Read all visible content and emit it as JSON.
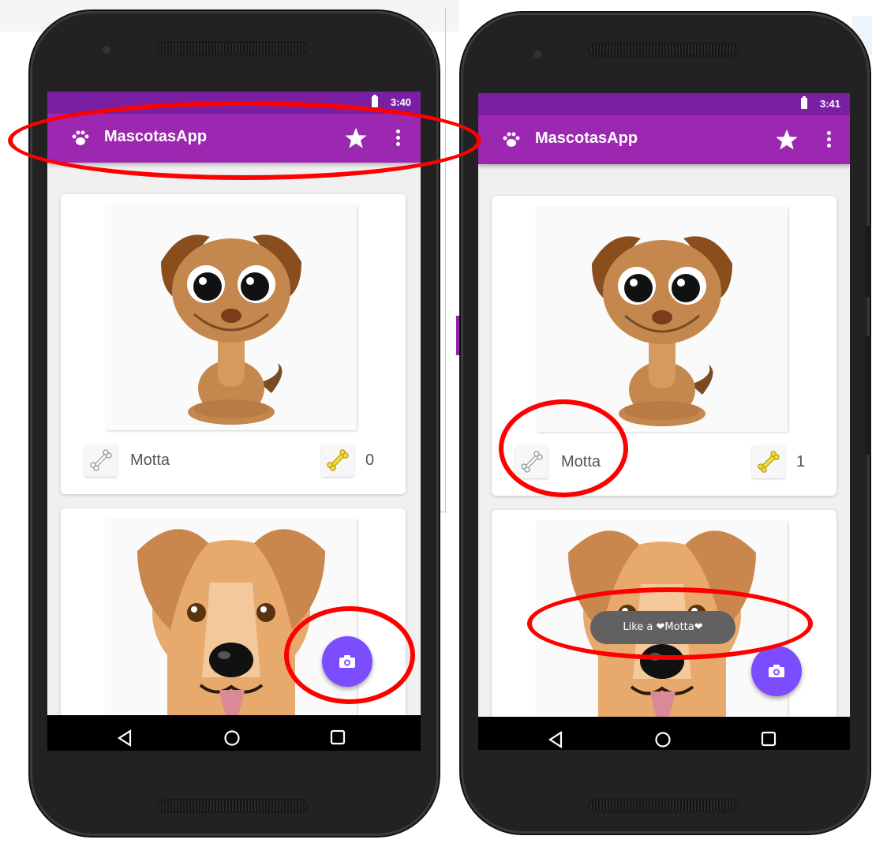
{
  "screens": [
    {
      "status_time": "3:40",
      "app_title": "MascotasApp",
      "pets": [
        {
          "name": "Motta",
          "likes": "0"
        }
      ]
    },
    {
      "status_time": "3:41",
      "app_title": "MascotasApp",
      "pets": [
        {
          "name": "Motta",
          "likes": "1"
        }
      ],
      "toast": "Like a ❤Motta❤"
    }
  ],
  "icons": {
    "app_logo": "paw-icon",
    "favorites": "star-icon",
    "overflow": "more-vert-icon",
    "like_button": "bone-icon",
    "fab": "camera-icon",
    "nav_back": "triangle-back-icon",
    "nav_home": "circle-home-icon",
    "nav_recents": "square-recents-icon"
  },
  "colors": {
    "status_bar": "#7b1fa2",
    "app_bar": "#9c27b0",
    "fab": "#7c4dff",
    "annotation": "#ff0000",
    "toast": "#616161"
  }
}
